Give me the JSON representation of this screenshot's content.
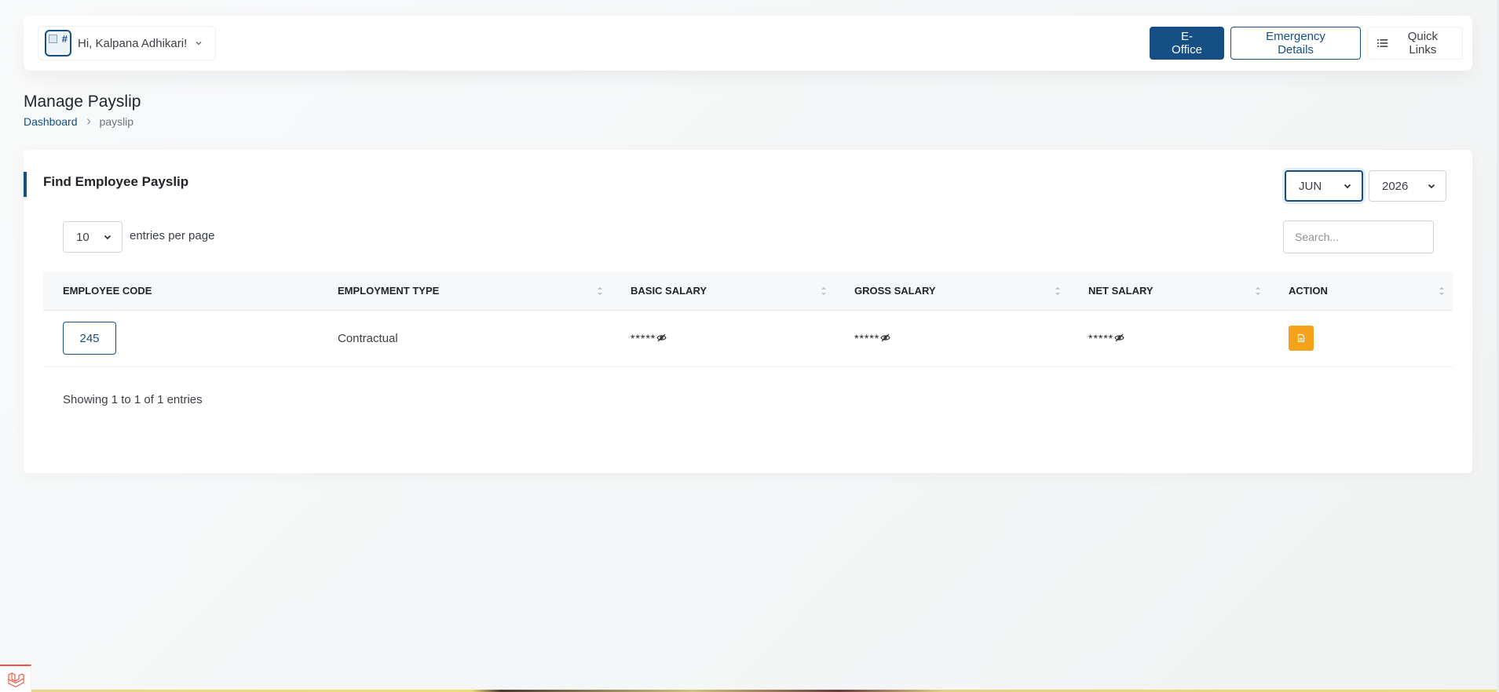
{
  "header": {
    "avatar_text": "#",
    "user_greeting": "Hi, Kalpana Adhikari!",
    "buttons": {
      "eoffice": "E-Office",
      "emergency": "Emergency Details",
      "quick_links": "Quick Links"
    }
  },
  "page": {
    "title": "Manage Payslip",
    "breadcrumb": {
      "home": "Dashboard",
      "current": "payslip"
    }
  },
  "card": {
    "title": "Find Employee Payslip",
    "month": "JUN",
    "year": "2026",
    "entries_per_page": "10",
    "entries_label": "entries per page",
    "search_placeholder": "Search...",
    "info": "Showing 1 to 1 of 1 entries"
  },
  "table": {
    "columns": [
      "EMPLOYEE CODE",
      "EMPLOYMENT TYPE",
      "BASIC SALARY",
      "GROSS SALARY",
      "NET SALARY",
      "ACTION"
    ],
    "rows": [
      {
        "employee_code": "245",
        "employment_type": "Contractual",
        "basic_salary": "*****",
        "gross_salary": "*****",
        "net_salary": "*****"
      }
    ]
  },
  "colors": {
    "primary": "#154f84",
    "action": "#f7a21b",
    "badge_accent": "#f05340"
  },
  "icons": {
    "user_menu": "chevron-down-icon",
    "quick_links": "list-icon",
    "sort": "sort-icon",
    "salary_toggle": "eye-slash-icon",
    "action": "document-icon",
    "dev_badge": "laravel-icon"
  }
}
